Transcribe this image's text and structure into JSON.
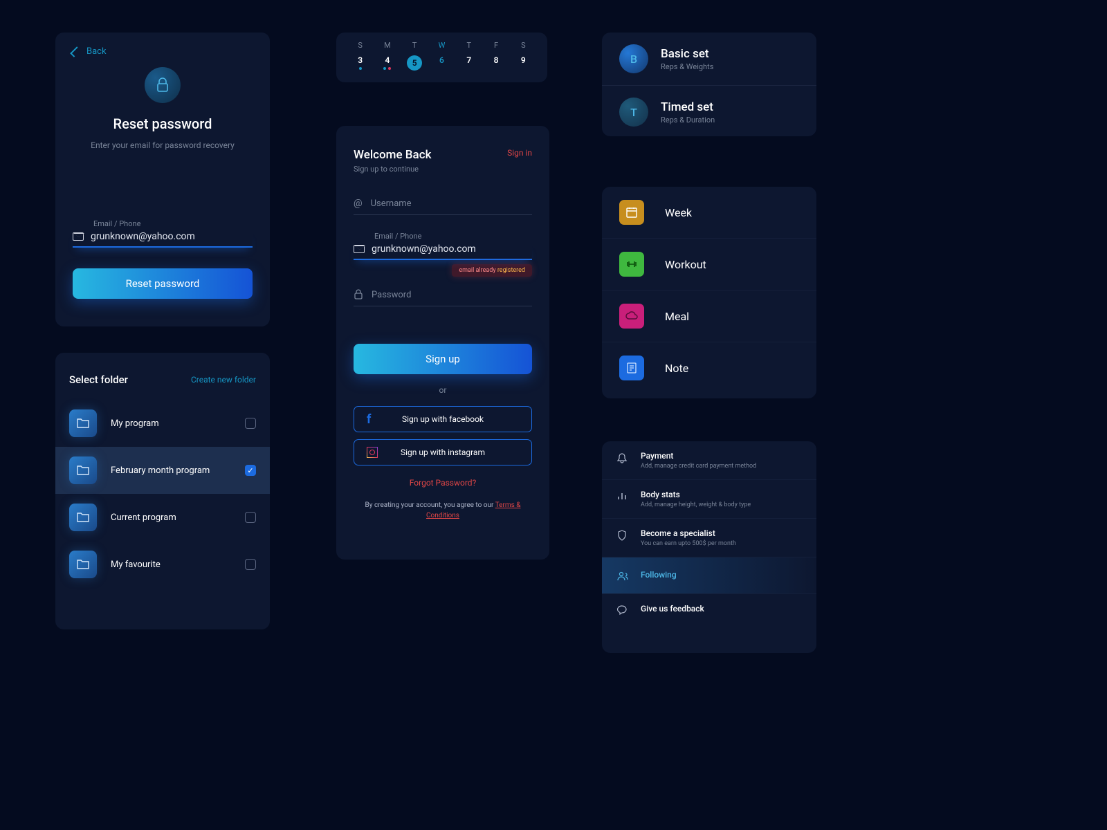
{
  "resetPassword": {
    "back": "Back",
    "title": "Reset password",
    "subtitle": "Enter your email for password recovery",
    "fieldLabel": "Email / Phone",
    "emailValue": "grunknown@yahoo.com",
    "button": "Reset password"
  },
  "selectFolder": {
    "title": "Select folder",
    "createLink": "Create new folder",
    "items": [
      {
        "label": "My program",
        "checked": false
      },
      {
        "label": "February month program",
        "checked": true
      },
      {
        "label": "Current program",
        "checked": false
      },
      {
        "label": "My favourite",
        "checked": false
      }
    ]
  },
  "calendar": {
    "days": [
      "S",
      "M",
      "T",
      "W",
      "T",
      "F",
      "S"
    ],
    "dates": [
      "3",
      "4",
      "5",
      "6",
      "7",
      "8",
      "9"
    ],
    "activeDayIndex": 3,
    "todayIndex": 2
  },
  "signup": {
    "welcome": "Welcome Back",
    "signin": "Sign in",
    "subtitle": "Sign up to continue",
    "usernamePlaceholder": "Username",
    "emailLabel": "Email / Phone",
    "emailValue": "grunknown@yahoo.com",
    "errorPrefix": "email already ",
    "errorSuffix": "registered",
    "passwordPlaceholder": "Password",
    "signupBtn": "Sign up",
    "or": "or",
    "facebook": "Sign up with facebook",
    "instagram": "Sign up with instagram",
    "forgot": "Forgot Password?",
    "termsPrefix": "By creating your account, you agree to our ",
    "termsLink": "Terms & Conditions"
  },
  "sets": {
    "items": [
      {
        "letter": "B",
        "title": "Basic set",
        "sub": "Reps & Weights"
      },
      {
        "letter": "T",
        "title": "Timed set",
        "sub": "Reps & Duration"
      }
    ]
  },
  "categories": {
    "items": [
      {
        "label": "Week",
        "color": "orange"
      },
      {
        "label": "Workout",
        "color": "green"
      },
      {
        "label": "Meal",
        "color": "magenta"
      },
      {
        "label": "Note",
        "color": "blue"
      }
    ]
  },
  "settings": {
    "items": [
      {
        "title": "Payment",
        "sub": "Add, manage credit card payment method"
      },
      {
        "title": "Body stats",
        "sub": "Add, manage height, weight & body type"
      },
      {
        "title": "Become a specialist",
        "sub": "You can earn upto 500$ per month"
      },
      {
        "title": "Following",
        "sub": ""
      },
      {
        "title": "Give us feedback",
        "sub": ""
      }
    ]
  }
}
